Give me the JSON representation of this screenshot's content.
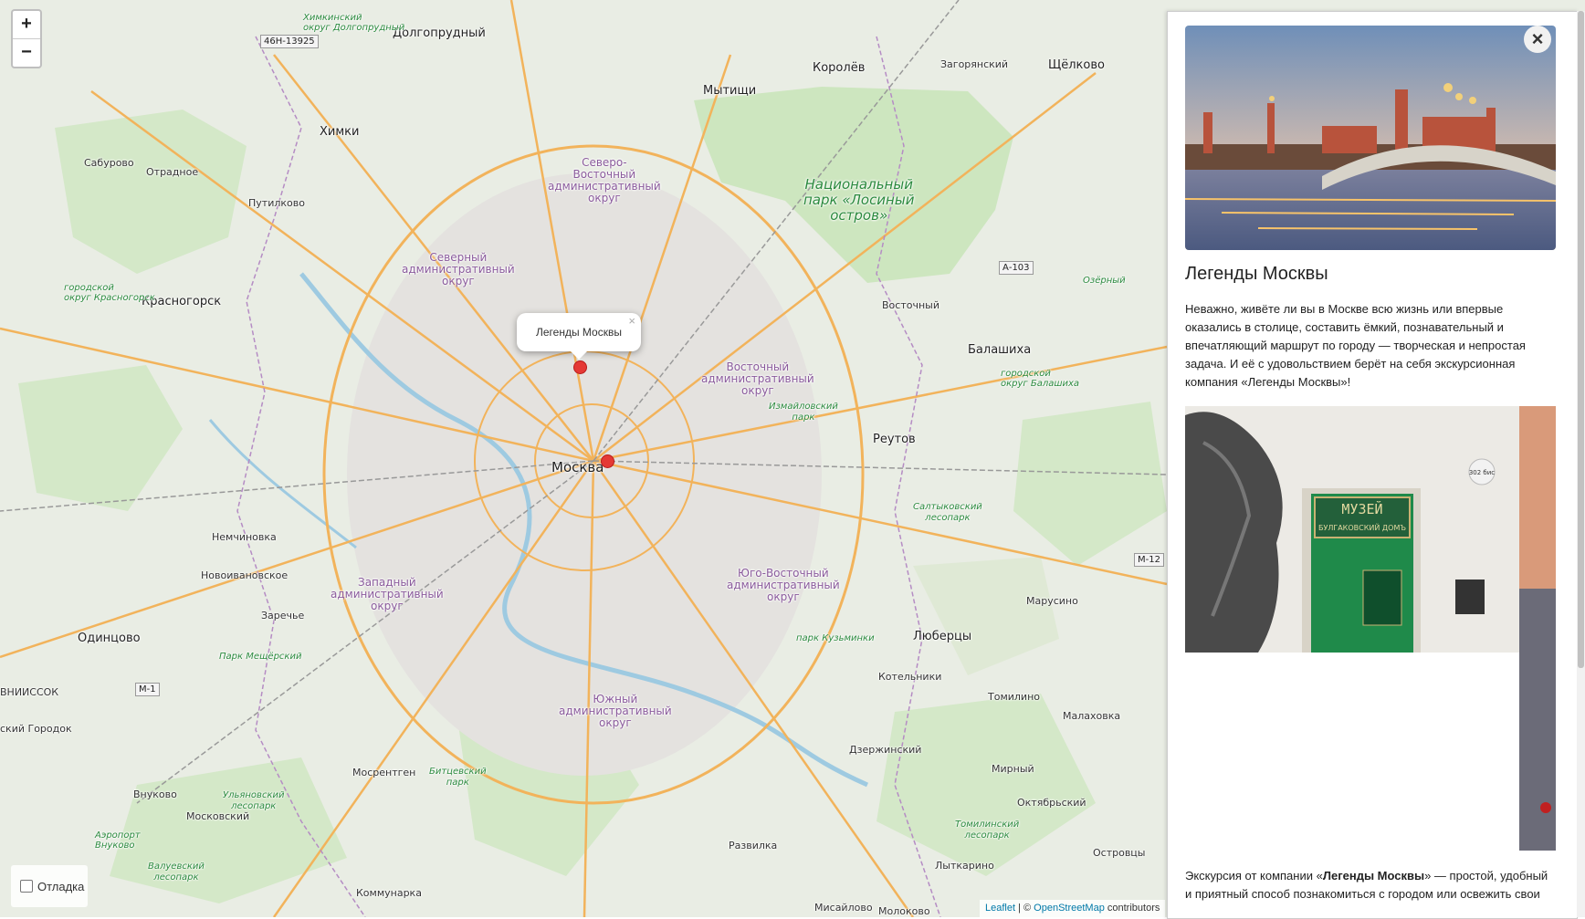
{
  "map": {
    "zoom_in": "+",
    "zoom_out": "−",
    "popup": {
      "text": "Легенды Москвы",
      "close": "×"
    },
    "debug_label": "Отладка",
    "attribution": {
      "leaflet": "Leaflet",
      "sep": " | © ",
      "osm": "OpenStreetMap",
      "suffix": " contributors"
    },
    "labels": {
      "moscow": "Москва",
      "dolgoprudny": "Долгопрудный",
      "mytishchi": "Мытищи",
      "korolev": "Королёв",
      "zagoryansky": "Загорянский",
      "shchelkovo": "Щёлково",
      "khimki": "Химки",
      "saburovo": "Сабурово",
      "otradnoe": "Отрадное",
      "putilkovo": "Путилково",
      "krasnogorsk": "Красногорск",
      "balashikha": "Балашиха",
      "vostochny": "Восточный",
      "reutov": "Реутов",
      "nemchinovka": "Немчиновка",
      "novoivanovskoe": "Новоивановское",
      "zarechye": "Заречье",
      "odintsovo": "Одинцово",
      "lyubertsy": "Люберцы",
      "marusino": "Марусино",
      "kotelniki": "Котельники",
      "tomilino": "Томилино",
      "malakhovka": "Малаховка",
      "dzerzhinsky": "Дзержинский",
      "mirny": "Мирный",
      "oktyabrsky": "Октябрьский",
      "mosrentgen": "Мосрентген",
      "vnukovo": "Внуково",
      "moskovsky": "Московский",
      "razvilka": "Развилка",
      "lytkarino": "Лыткарино",
      "ostrovtsy": "Островцы",
      "kommunarka": "Коммунарка",
      "misaylovo": "Мисайлово",
      "molokovo": "Молоково",
      "vnissoc": "ВНИИССОК",
      "nk_gorodok": "ский Городок",
      "aeroport": "Аэропорт\nВнуково"
    },
    "districts": {
      "sevvost": "Северо-\nВосточный\nадминистративный\nокруг",
      "sever": "Северный\nадминистративный\nокруг",
      "vost": "Восточный\nадминистративный\nокруг",
      "zapad": "Западный\nадминистративный\nокруг",
      "yugvost": "Юго-Восточный\nадминистративный\nокруг",
      "yuzh": "Южный\nадминистративный\nокруг"
    },
    "parks": {
      "losiny": "Национальный\nпарк «Лосиный\nостров»",
      "izmaylovsky": "Измайловский\nпарк",
      "kuzminki": "парк Кузьминки",
      "meshchersky": "Парк Мещёрский",
      "bitsevsky": "Битцевский\nпарк",
      "saltykovsky": "Салтыковский\nлесопарк",
      "tominsky": "Томилинский\nлесопарк",
      "ulyanovsky": "Ульяновский\nлесопарк",
      "valuevsky": "Валуевский\nлесопарк",
      "krasnogorsk_okrug": "городской\nокруг Красногорск",
      "balashikha_okrug": "городской\nокруг Балашиха",
      "ozerny": "Озёрный",
      "khimki_okrug": "Химкинский\nокруг Долгопрудный"
    },
    "roads": {
      "r1": "46Н-13925",
      "r2": "А-103",
      "r3": "М-12",
      "r4": "М-1"
    },
    "colors": {
      "marker": "#e53935",
      "district": "#8a5a9c",
      "park": "#2b8a3e"
    }
  },
  "panel": {
    "close": "×",
    "title": "Легенды Москвы",
    "intro": "Неважно, живёте ли вы в Москве всю жизнь или впервые оказались в столице, составить ёмкий, познавательный и впечатляющий маршрут по городу — творческая и непростая задача. И её с удовольствием берёт на себя экскурсионная компания «Легенды Москвы»!",
    "museum_sign": "МУЗЕЙ",
    "museum_sub": "БУЛГАКОВСКИЙ ДОМЪ",
    "plaque": "302 бис",
    "outro_pre": "Экскурсия от компании «",
    "outro_bold": "Легенды Москвы",
    "outro_post": "» — простой, удобный и приятный способ познакомиться с городом или освежить свои"
  }
}
